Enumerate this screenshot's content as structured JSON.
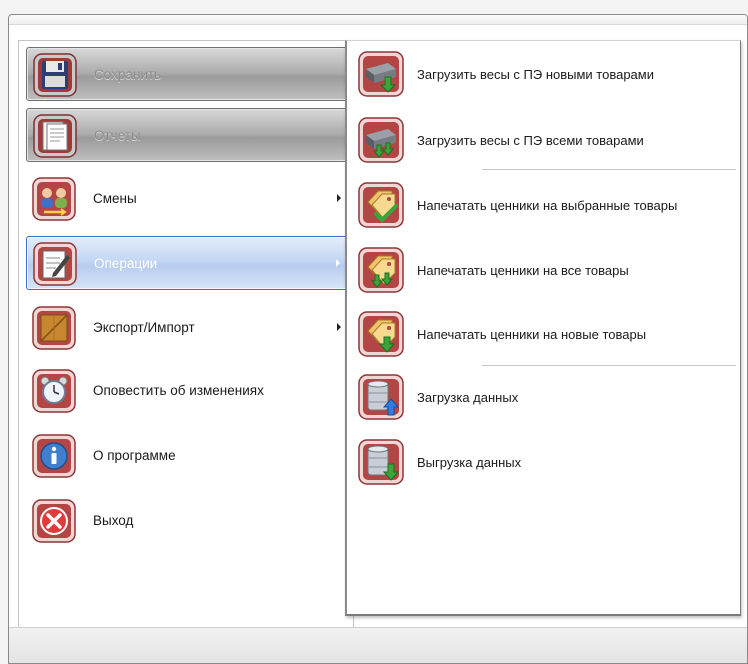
{
  "left_menu": {
    "items": [
      {
        "label": "Сохранить",
        "state": "disabled",
        "has_submenu": false,
        "icon": "floppy-disk-icon"
      },
      {
        "label": "Отчеты",
        "state": "disabled",
        "has_submenu": false,
        "icon": "report-document-icon"
      },
      {
        "label": "Смены",
        "state": "normal",
        "has_submenu": true,
        "icon": "shift-users-icon"
      },
      {
        "label": "Операции",
        "state": "selected",
        "has_submenu": true,
        "icon": "clipboard-edit-icon"
      },
      {
        "label": "Экспорт/Импорт",
        "state": "normal",
        "has_submenu": true,
        "icon": "box-export-icon"
      },
      {
        "label": "Оповестить об изменениях",
        "state": "normal",
        "has_submenu": false,
        "icon": "alarm-clock-icon"
      },
      {
        "label": "О программе",
        "state": "normal",
        "has_submenu": false,
        "icon": "info-icon"
      },
      {
        "label": "Выход",
        "state": "normal",
        "has_submenu": false,
        "icon": "exit-icon"
      }
    ]
  },
  "submenu": {
    "parent": "Операции",
    "items": [
      {
        "label": "Загрузить весы с ПЭ новыми товарами",
        "icon": "scale-download-new-icon"
      },
      {
        "label": "Загрузить весы с ПЭ всеми товарами",
        "icon": "scale-download-all-icon"
      },
      {
        "label": "Напечатать ценники на выбранные товары",
        "icon": "price-tag-check-icon"
      },
      {
        "label": "Напечатать ценники на все товары",
        "icon": "price-tag-all-icon"
      },
      {
        "label": "Напечатать ценники на новые товары",
        "icon": "price-tag-new-icon"
      },
      {
        "label": "Загрузка данных",
        "icon": "database-upload-icon"
      },
      {
        "label": "Выгрузка данных",
        "icon": "database-download-icon"
      }
    ]
  },
  "colors": {
    "selection_border": "#3a73c8",
    "disabled_fill": "#a9a9a9",
    "icon_frame": "#a33b3b",
    "arrow_green": "#3aa53a",
    "arrow_blue": "#2f7de0"
  }
}
